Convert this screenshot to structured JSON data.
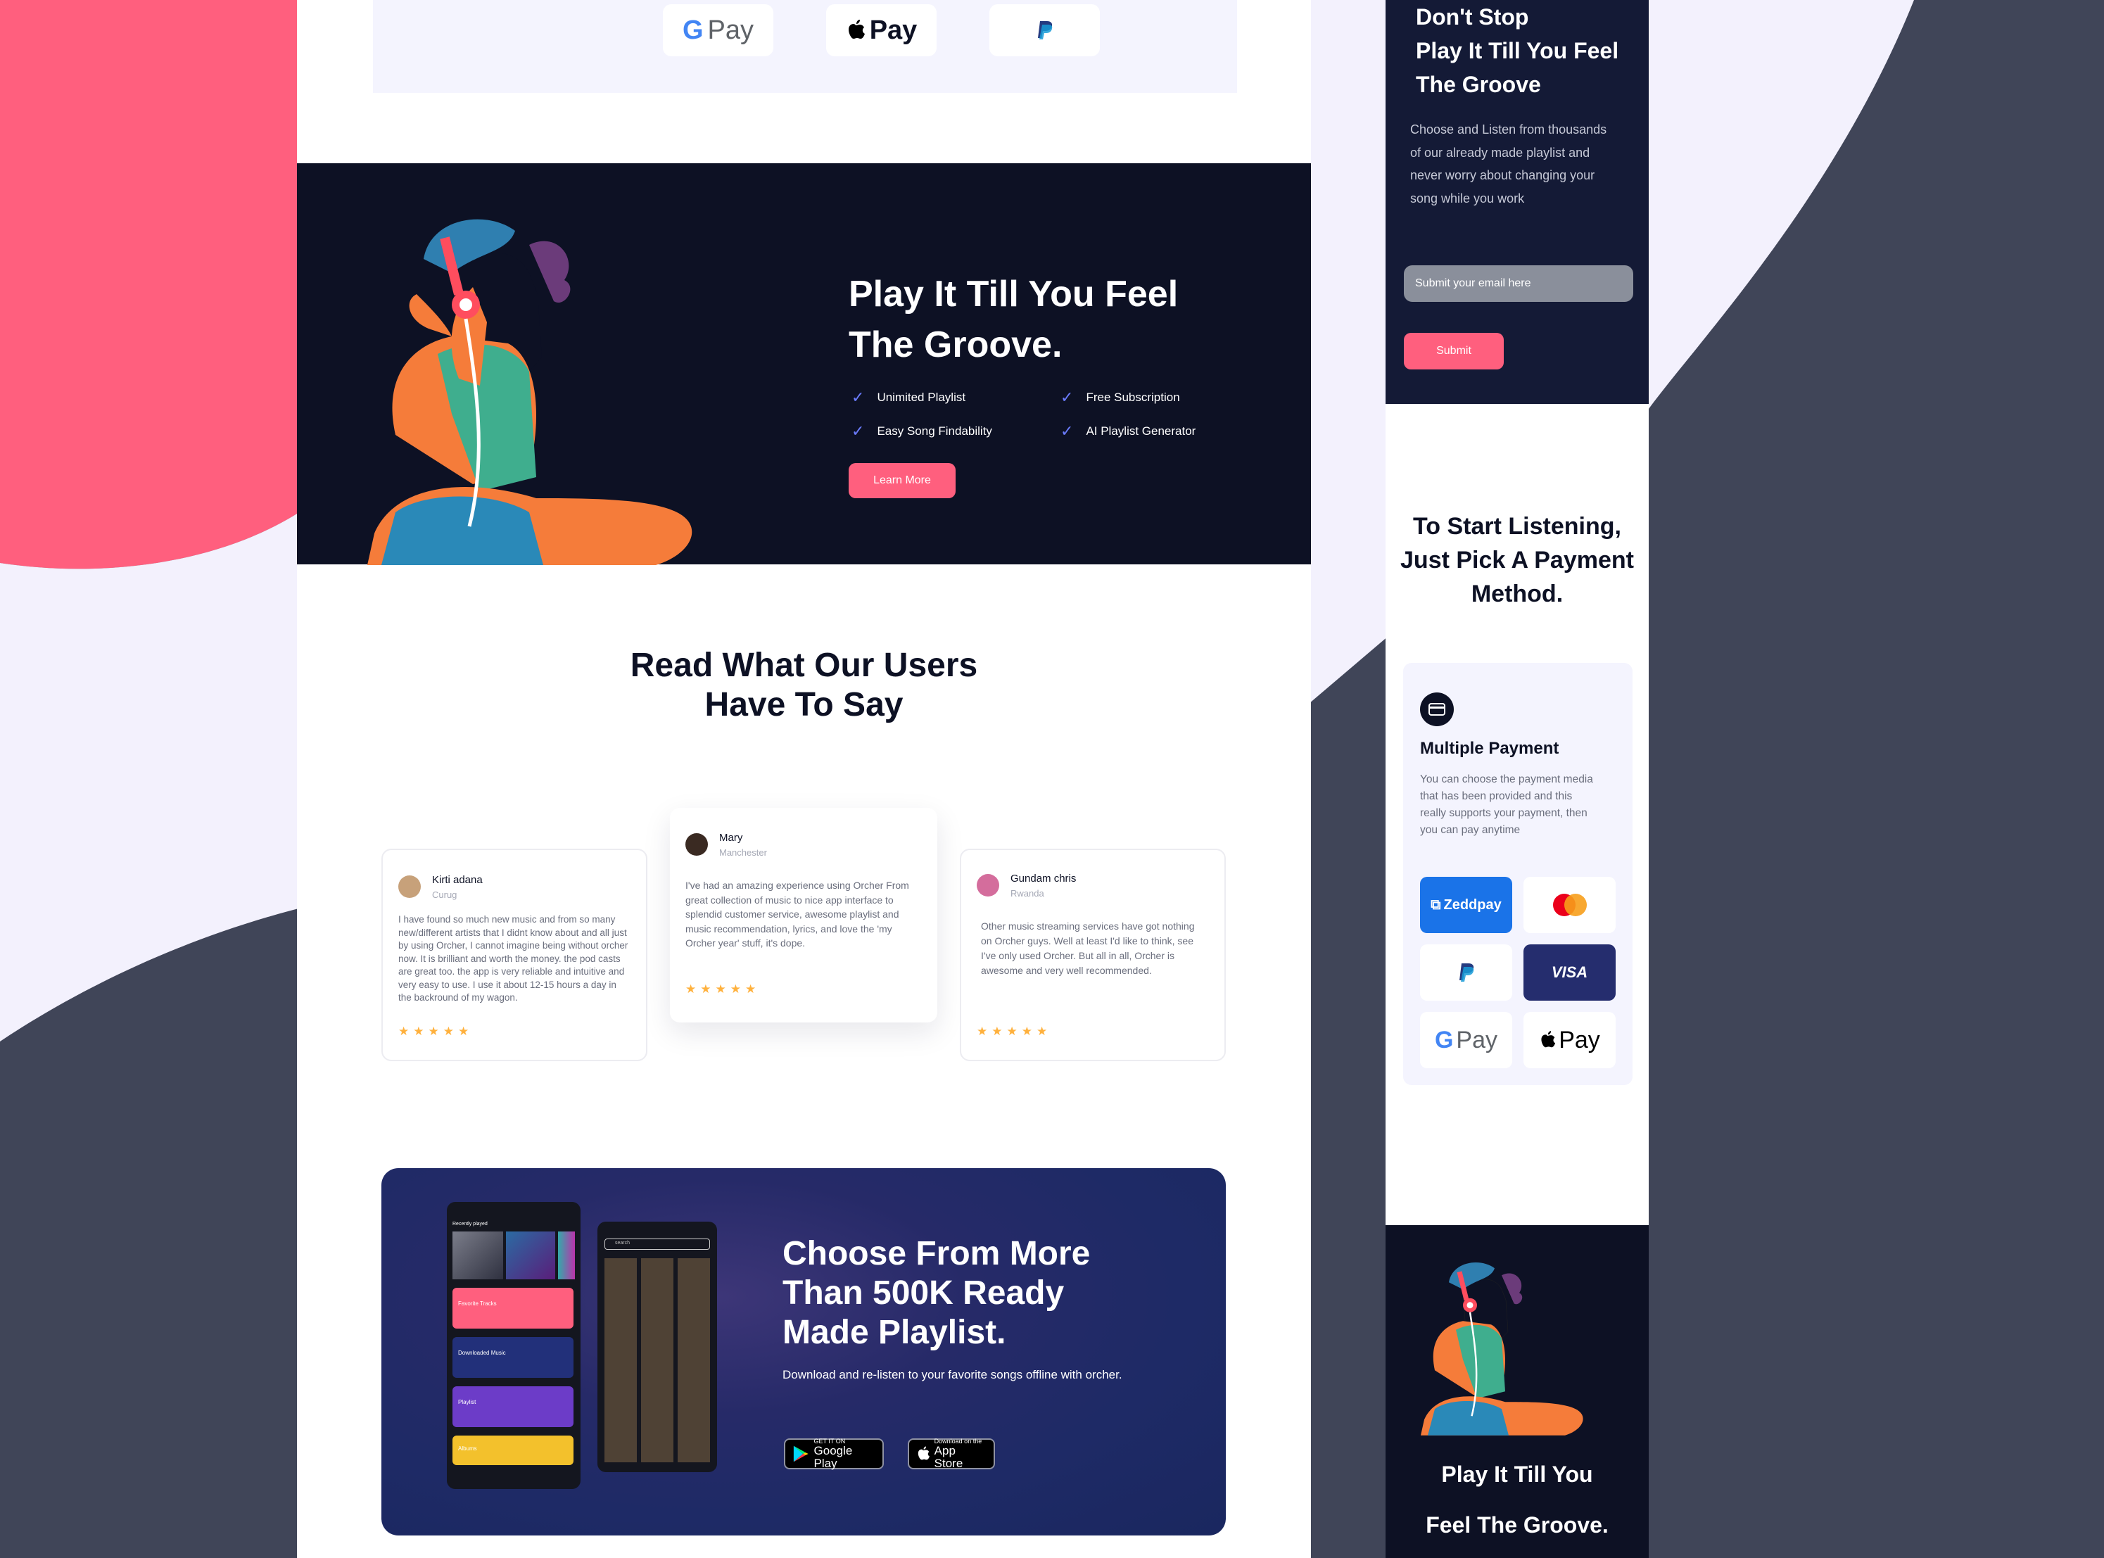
{
  "payment_strip": {
    "gpay": "Pay",
    "apple": "Pay"
  },
  "hero": {
    "title_line1": "Play It Till You Feel",
    "title_line2": "The Groove.",
    "features": [
      "Unimited Playlist",
      "Free Subscription",
      "Easy Song Findability",
      "AI Playlist Generator"
    ],
    "cta": "Learn More"
  },
  "testimonials": {
    "title_line1": "Read What Our Users",
    "title_line2": "Have To Say",
    "reviews": [
      {
        "name": "Kirti adana",
        "location": "Curug",
        "text": "I have found so much new music and from so many new/different artists that I didnt know about and all just by using Orcher, I cannot imagine being without orcher now. It is brilliant and worth the money. the pod casts are great too. the app is very reliable and intuitive and very easy to use. I use it about 12-15 hours a day in the backround of my wagon.",
        "stars": "★★★★★"
      },
      {
        "name": "Mary",
        "location": "Manchester",
        "text": "I've had an amazing experience using Orcher From great collection of music to nice app interface to splendid customer service, awesome playlist and music recommendation, lyrics, and love the 'my Orcher year' stuff, it's dope.",
        "stars": "★★★★★"
      },
      {
        "name": "Gundam chris",
        "location": "Rwanda",
        "text": "Other music streaming services have got nothing on Orcher guys. Well at least I'd like to think, see I've only used Orcher. But all in all, Orcher is awesome and very well recommended.",
        "stars": "★★★★★"
      }
    ]
  },
  "download": {
    "title_line1": "Choose From More",
    "title_line2": "Than 500K Ready",
    "title_line3": "Made Playlist.",
    "subtitle": "Download and re-listen to your favorite songs offline with orcher.",
    "google_small": "GET IT ON",
    "google_big": "Google Play",
    "apple_small": "Download on the",
    "apple_big": "App Store",
    "phone_a": {
      "header": "Recently played",
      "cards": [
        "Favorite Tracks",
        "Downloaded Music",
        "Playlist",
        "Albums"
      ]
    },
    "phone_b": {
      "search": "search"
    }
  },
  "mobile": {
    "hero_line1": "Don't Stop",
    "hero_line2": "Play It Till You Feel",
    "hero_line3": "The Groove",
    "hero_text": "Choose and Listen from thousands of our already made playlist and never worry about changing your song while you work",
    "email_placeholder": "Submit your email here",
    "submit": "Submit",
    "pay_title_line1": "To Start Listening,",
    "pay_title_line2": "Just Pick A Payment",
    "pay_title_line3": "Method.",
    "panel_title": "Multiple Payment",
    "panel_text": "You can choose the payment media that has been provided and this really supports your payment, then you can pay anytime",
    "tiles": {
      "zeddpay": "Zeddpay",
      "visa": "VISA",
      "gpay": "Pay",
      "apple": "Pay"
    },
    "bottom_line1": "Play It Till You",
    "bottom_line2": "Feel The Groove."
  },
  "colors": {
    "navy": "#0d1124",
    "pink": "#ff5f7e",
    "lavender": "#f4f4fe",
    "banner": "#1e2a66",
    "zeddpay": "#1a73e8",
    "visa": "#252d6e"
  }
}
